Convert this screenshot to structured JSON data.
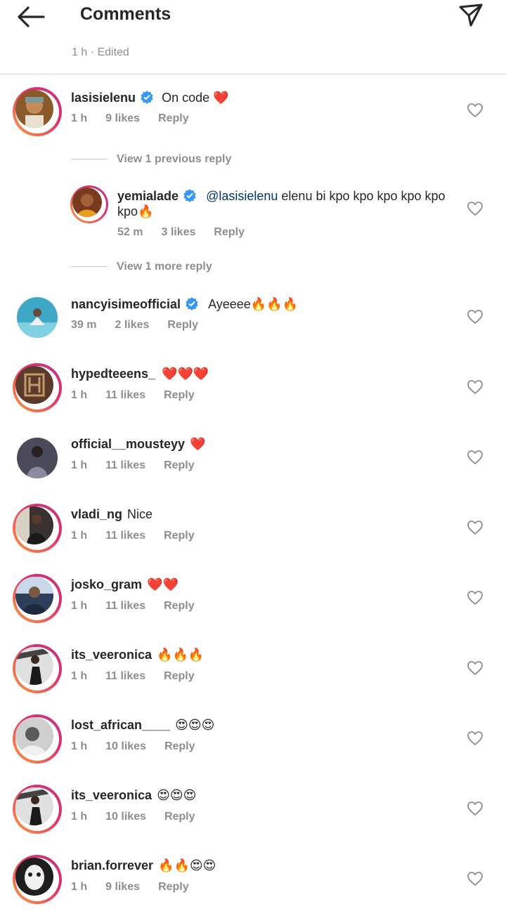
{
  "header": {
    "title": "Comments",
    "subline": "1 h · Edited"
  },
  "comments": [
    {
      "user": "lasisielenu",
      "verified": true,
      "text": "On code ❤️",
      "time": "1 h",
      "likes": "9 likes",
      "reply": "Reply",
      "ring": true,
      "avatar_color": "#8b5a2b"
    },
    {
      "user": "nancyisimeofficial",
      "verified": true,
      "text": "Ayeeee🔥🔥🔥",
      "time": "39 m",
      "likes": "2 likes",
      "reply": "Reply",
      "ring": false,
      "avatar_color": "#3fa8c4"
    },
    {
      "user": "hypedteeens_",
      "verified": false,
      "text": "❤️❤️❤️",
      "time": "1 h",
      "likes": "11 likes",
      "reply": "Reply",
      "ring": true,
      "avatar_color": "#5a3a2a"
    },
    {
      "user": "official__mousteyy",
      "verified": false,
      "text": "❤️",
      "time": "1 h",
      "likes": "11 likes",
      "reply": "Reply",
      "ring": false,
      "avatar_color": "#4a4a5a"
    },
    {
      "user": "vladi_ng",
      "verified": false,
      "text": "Nice",
      "time": "1 h",
      "likes": "11 likes",
      "reply": "Reply",
      "ring": true,
      "avatar_color": "#3a3230"
    },
    {
      "user": "josko_gram",
      "verified": false,
      "text": "❤️❤️",
      "time": "1 h",
      "likes": "11 likes",
      "reply": "Reply",
      "ring": true,
      "avatar_color": "#2e3e58"
    },
    {
      "user": "its_veeronica",
      "verified": false,
      "text": "🔥🔥🔥",
      "time": "1 h",
      "likes": "11 likes",
      "reply": "Reply",
      "ring": true,
      "avatar_color": "#2a2a2a"
    },
    {
      "user": "lost_african____",
      "verified": false,
      "text": "😍😍😍",
      "time": "1 h",
      "likes": "10 likes",
      "reply": "Reply",
      "ring": true,
      "avatar_color": "#6a6a6a"
    },
    {
      "user": "its_veeronica",
      "verified": false,
      "text": "😍😍😍",
      "time": "1 h",
      "likes": "10 likes",
      "reply": "Reply",
      "ring": true,
      "avatar_color": "#2a2a2a"
    },
    {
      "user": "brian.forrever",
      "verified": false,
      "text": "🔥🔥😍😍",
      "time": "1 h",
      "likes": "9 likes",
      "reply": "Reply",
      "ring": true,
      "avatar_color": "#1e1e1e"
    }
  ],
  "thread": {
    "view_previous": "View 1 previous reply",
    "view_more": "View 1 more reply",
    "reply_item": {
      "user": "yemialade",
      "verified": true,
      "mention": "@lasisielenu",
      "text": " elenu  bi kpo kpo kpo kpo kpo kpo🔥",
      "time": "52 m",
      "likes": "3 likes",
      "reply": "Reply",
      "avatar_color": "#7a3a20"
    }
  },
  "colors": {
    "verified": "#3897f0",
    "meta": "#8e8e8e",
    "mention": "#00376b"
  },
  "icons": {
    "back": "arrow-left-icon",
    "send": "paper-plane-icon",
    "like": "heart-outline-icon",
    "verified": "verified-badge-icon"
  }
}
